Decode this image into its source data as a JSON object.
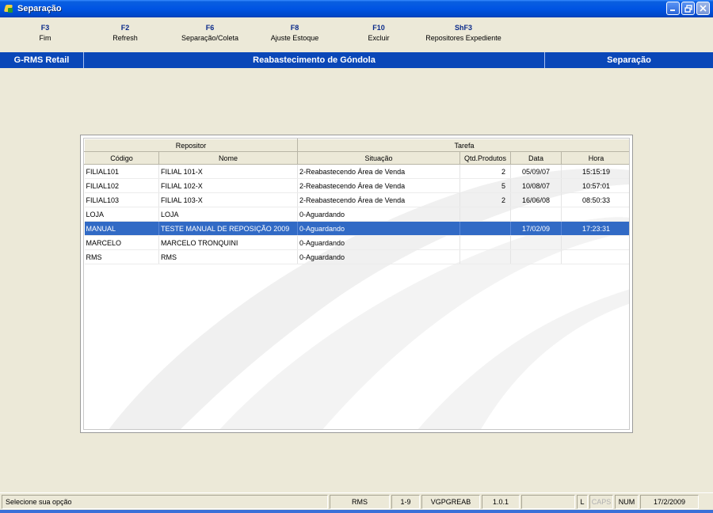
{
  "window": {
    "title": "Separação"
  },
  "function_keys": [
    {
      "key": "F3",
      "label": "Fim"
    },
    {
      "key": "F2",
      "label": "Refresh"
    },
    {
      "key": "F6",
      "label": "Separação/Coleta"
    },
    {
      "key": "F8",
      "label": "Ajuste Estoque"
    },
    {
      "key": "F10",
      "label": "Excluir"
    },
    {
      "key": "ShF3",
      "label": "Repositores Expediente"
    }
  ],
  "header": {
    "app_name": "G-RMS Retail",
    "screen_title": "Reabastecimento de Góndola",
    "module": "Separação"
  },
  "grid": {
    "group_headers": {
      "repositor": "Repositor",
      "tarefa": "Tarefa"
    },
    "columns": [
      "Código",
      "Nome",
      "Situação",
      "Qtd.Produtos",
      "Data",
      "Hora"
    ],
    "rows": [
      {
        "codigo": "FILIAL101",
        "nome": "FILIAL 101-X",
        "situacao": "2-Reabastecendo Área de Venda",
        "qtd": "2",
        "data": "05/09/07",
        "hora": "15:15:19"
      },
      {
        "codigo": "FILIAL102",
        "nome": "FILIAL 102-X",
        "situacao": "2-Reabastecendo Área de Venda",
        "qtd": "5",
        "data": "10/08/07",
        "hora": "10:57:01"
      },
      {
        "codigo": "FILIAL103",
        "nome": "FILIAL 103-X",
        "situacao": "2-Reabastecendo Área de Venda",
        "qtd": "2",
        "data": "16/06/08",
        "hora": "08:50:33"
      },
      {
        "codigo": "LOJA",
        "nome": "LOJA",
        "situacao": "0-Aguardando",
        "qtd": "",
        "data": "",
        "hora": ""
      },
      {
        "codigo": "MANUAL",
        "nome": "TESTE MANUAL DE REPOSIÇÃO 2009",
        "situacao": "0-Aguardando",
        "qtd": "",
        "data": "17/02/09",
        "hora": "17:23:31",
        "selected": true
      },
      {
        "codigo": "MARCELO",
        "nome": "MARCELO TRONQUINI",
        "situacao": "0-Aguardando",
        "qtd": "",
        "data": "",
        "hora": ""
      },
      {
        "codigo": "RMS",
        "nome": "RMS",
        "situacao": "0-Aguardando",
        "qtd": "",
        "data": "",
        "hora": ""
      }
    ]
  },
  "statusbar": {
    "message": "Selecione sua opção",
    "user": "RMS",
    "range": "1-9",
    "program": "VGPGREAB",
    "version": "1.0.1",
    "empty": "",
    "l": "L",
    "caps": "CAPS",
    "num": "NUM",
    "date": "17/2/2009"
  },
  "colors": {
    "title_bar": "#0054e3",
    "header_band": "#0a47b8",
    "selected_row": "#316ac5",
    "background": "#ece9d8"
  }
}
